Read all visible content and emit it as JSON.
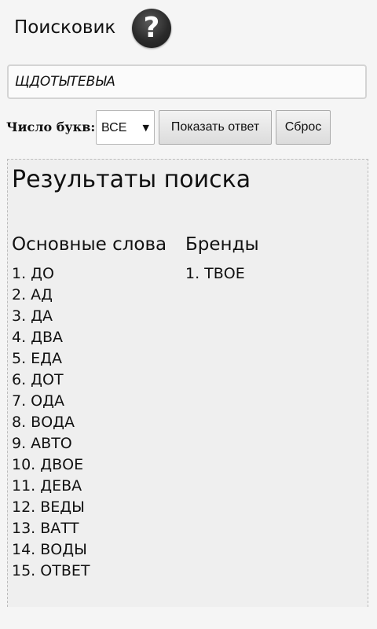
{
  "header": {
    "title": "Поисковик",
    "help_glyph": "?",
    "help_icon": "question-circle-icon"
  },
  "search": {
    "value": "ЩДОТЫТЕВЫА"
  },
  "controls": {
    "count_label": "Число букв:",
    "count_select_value": "ВСЕ",
    "count_select_arrow": "▼",
    "show_answer_label": "Показать ответ",
    "reset_label": "Сброс"
  },
  "results": {
    "title": "Результаты поиска",
    "main_heading": "Основные слова",
    "main_words": [
      "1. ДО",
      "2. АД",
      "3. ДА",
      "4. ДВА",
      "5. ЕДА",
      "6. ДОТ",
      "7. ОДА",
      "8. ВОДА",
      "9. АВТО",
      "10. ДВОЕ",
      "11. ДЕВА",
      "12. ВЕДЫ",
      "13. ВАТТ",
      "14. ВОДЫ",
      "15. ОТВЕТ"
    ],
    "brands_heading": "Бренды",
    "brand_words": [
      "1. ТВОЕ"
    ]
  }
}
